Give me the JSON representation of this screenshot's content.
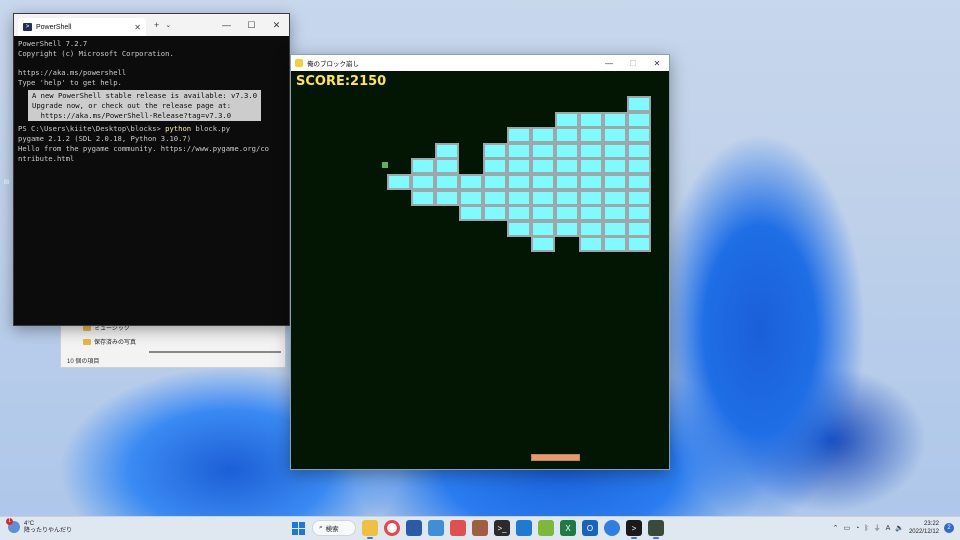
{
  "desktop": {
    "side_label": "Bl"
  },
  "explorer": {
    "folders": [
      "ミュージック",
      "保存済みの写真"
    ],
    "item_count": "10 個の項目"
  },
  "powershell": {
    "tab_title": "PowerShell",
    "new_tab": "+",
    "lines": {
      "l1": "PowerShell 7.2.7",
      "l2": "Copyright (c) Microsoft Corporation.",
      "l3": "https://aka.ms/powershell",
      "l4": "Type 'help' to get help.",
      "notice1": "A new PowerShell stable release is available: v7.3.0",
      "notice2": "Upgrade now, or check out the release page at:",
      "notice3": "  https://aka.ms/PowerShell-Release?tag=v7.3.0",
      "prompt": "PS C:\\Users\\kiite\\Desktop\\blocks> ",
      "command": "python",
      "arg": " block.py",
      "out1": "pygame 2.1.2 (SDL 2.0.18, Python 3.10.7)",
      "out2": "Hello from the pygame community. https://www.pygame.org/co",
      "out3": "ntribute.html"
    }
  },
  "game": {
    "title": "俺のブロック崩し",
    "score": "SCORE:2150",
    "block_color": "#7ffaff",
    "block_rows": [
      [
        0,
        0,
        0,
        0,
        0,
        0,
        0,
        0,
        0,
        0,
        1
      ],
      [
        0,
        0,
        0,
        0,
        0,
        0,
        0,
        1,
        1,
        1,
        1
      ],
      [
        0,
        0,
        0,
        0,
        0,
        1,
        1,
        1,
        1,
        1,
        1
      ],
      [
        0,
        0,
        1,
        0,
        1,
        1,
        1,
        1,
        1,
        1,
        1
      ],
      [
        0,
        1,
        1,
        0,
        1,
        1,
        1,
        1,
        1,
        1,
        1
      ],
      [
        1,
        1,
        1,
        1,
        1,
        1,
        1,
        1,
        1,
        1,
        1
      ],
      [
        0,
        1,
        1,
        1,
        1,
        1,
        1,
        1,
        1,
        1,
        1
      ],
      [
        0,
        0,
        0,
        1,
        1,
        1,
        1,
        1,
        1,
        1,
        1
      ],
      [
        0,
        0,
        0,
        0,
        0,
        1,
        1,
        1,
        1,
        1,
        1
      ],
      [
        0,
        0,
        0,
        0,
        0,
        0,
        1,
        0,
        1,
        1,
        1
      ]
    ]
  },
  "taskbar": {
    "weather_temp": "4°C",
    "weather_desc": "降ったりやんだり",
    "weather_badge": "1",
    "search_label": "検索",
    "ime": "A",
    "time": "23:22",
    "date": "2022/12/12",
    "notifications": "2"
  }
}
